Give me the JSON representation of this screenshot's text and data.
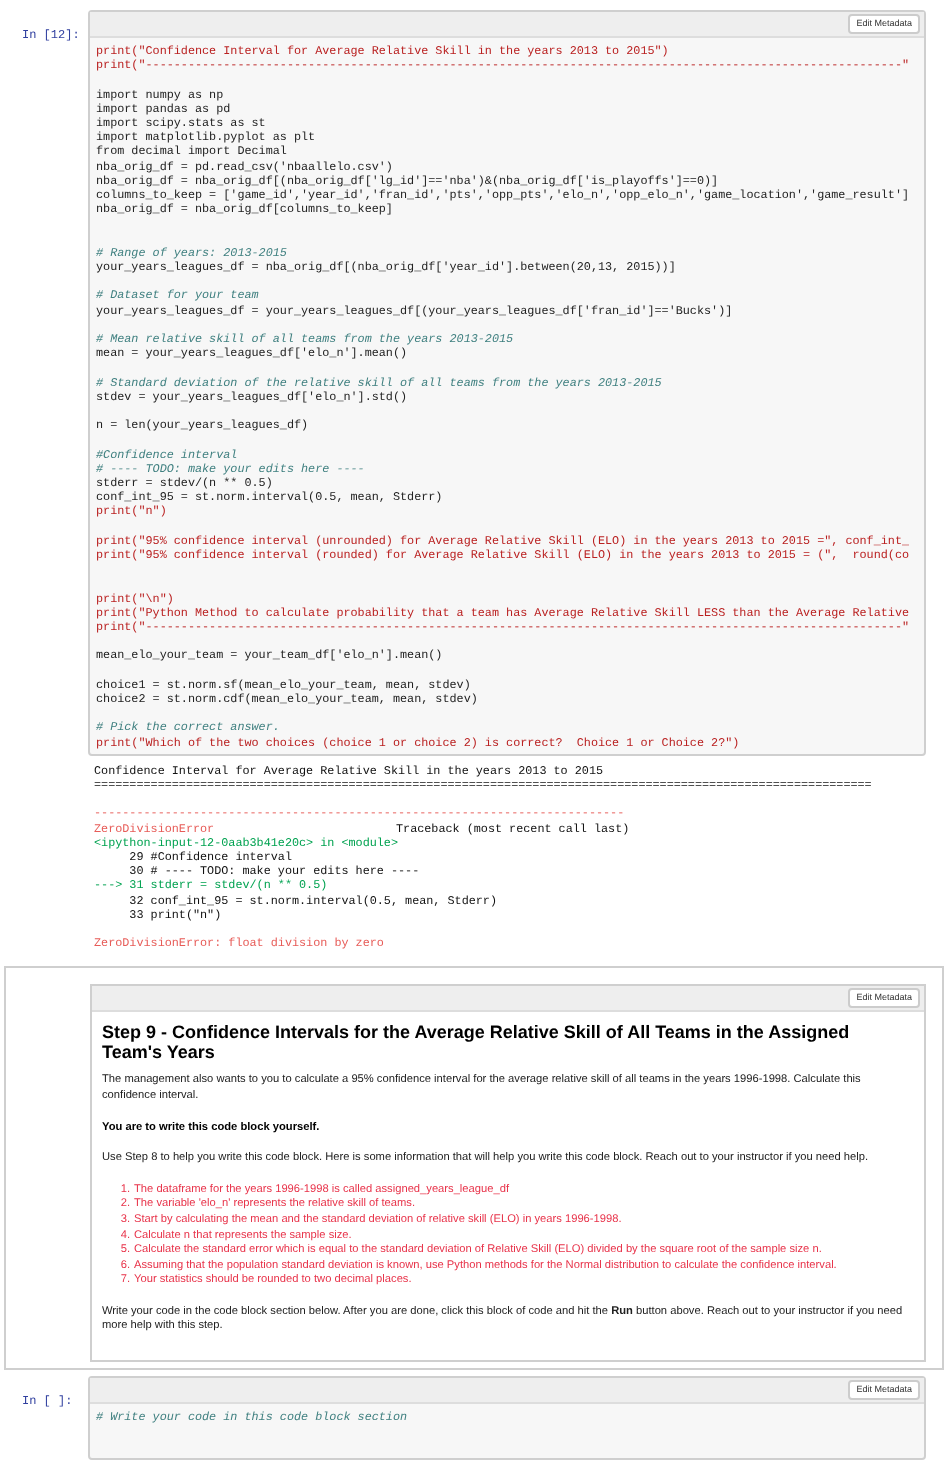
{
  "cells": [
    {
      "kind": "code",
      "prompt": "In [12]:",
      "toolbar_button": "Edit Metadata",
      "lines": [
        {
          "kind": "print",
          "text": "print(\"Confidence Interval for Average Relative Skill in the years 2013 to 2015\")"
        },
        {
          "kind": "print",
          "text": "print(\"-----------------------------------------------------------------------------------------------------------\""
        },
        {
          "kind": "blank"
        },
        {
          "kind": "code",
          "text": "import numpy as np"
        },
        {
          "kind": "code",
          "text": "import pandas as pd"
        },
        {
          "kind": "code",
          "text": "import scipy.stats as st"
        },
        {
          "kind": "code",
          "text": "import matplotlib.pyplot as plt"
        },
        {
          "kind": "code",
          "text": "from decimal import Decimal"
        },
        {
          "kind": "code",
          "text": "nba_orig_df = pd.read_csv('nbaallelo.csv')"
        },
        {
          "kind": "code",
          "text": "nba_orig_df = nba_orig_df[(nba_orig_df['lg_id']=='nba')&(nba_orig_df['is_playoffs']==0)]"
        },
        {
          "kind": "code",
          "text": "columns_to_keep = ['game_id','year_id','fran_id','pts','opp_pts','elo_n','opp_elo_n','game_location','game_result']"
        },
        {
          "kind": "code",
          "text": "nba_orig_df = nba_orig_df[columns_to_keep]"
        },
        {
          "kind": "blank"
        },
        {
          "kind": "blank"
        },
        {
          "kind": "comment",
          "text": "# Range of years: 2013-2015"
        },
        {
          "kind": "code",
          "text": "your_years_leagues_df = nba_orig_df[(nba_orig_df['year_id'].between(20,13, 2015))]"
        },
        {
          "kind": "blank"
        },
        {
          "kind": "comment",
          "text": "# Dataset for your team"
        },
        {
          "kind": "code",
          "text": "your_years_leagues_df = your_years_leagues_df[(your_years_leagues_df['fran_id']=='Bucks')]"
        },
        {
          "kind": "blank"
        },
        {
          "kind": "comment",
          "text": "# Mean relative skill of all teams from the years 2013-2015"
        },
        {
          "kind": "code",
          "text": "mean = your_years_leagues_df['elo_n'].mean()"
        },
        {
          "kind": "blank"
        },
        {
          "kind": "comment",
          "text": "# Standard deviation of the relative skill of all teams from the years 2013-2015"
        },
        {
          "kind": "code",
          "text": "stdev = your_years_leagues_df['elo_n'].std()"
        },
        {
          "kind": "blank"
        },
        {
          "kind": "code",
          "text": "n = len(your_years_leagues_df)"
        },
        {
          "kind": "blank"
        },
        {
          "kind": "comment",
          "text": "#Confidence interval"
        },
        {
          "kind": "comment",
          "text": "# ---- TODO: make your edits here ----"
        },
        {
          "kind": "code",
          "text": "stderr = stdev/(n ** 0.5)"
        },
        {
          "kind": "code",
          "text": "conf_int_95 = st.norm.interval(0.5, mean, Stderr)"
        },
        {
          "kind": "print",
          "text": "print(\"n\")"
        },
        {
          "kind": "blank"
        },
        {
          "kind": "print",
          "text": "print(\"95% confidence interval (unrounded) for Average Relative Skill (ELO) in the years 2013 to 2015 =\", conf_int_"
        },
        {
          "kind": "print",
          "text": "print(\"95% confidence interval (rounded) for Average Relative Skill (ELO) in the years 2013 to 2015 = (\",  round(co"
        },
        {
          "kind": "blank"
        },
        {
          "kind": "blank"
        },
        {
          "kind": "print",
          "text": "print(\"\\n\")"
        },
        {
          "kind": "print",
          "text": "print(\"Python Method to calculate probability that a team has Average Relative Skill LESS than the Average Relative"
        },
        {
          "kind": "print",
          "text": "print(\"-----------------------------------------------------------------------------------------------------------\""
        },
        {
          "kind": "blank"
        },
        {
          "kind": "code",
          "text": "mean_elo_your_team = your_team_df['elo_n'].mean()"
        },
        {
          "kind": "blank"
        },
        {
          "kind": "code",
          "text": "choice1 = st.norm.sf(mean_elo_your_team, mean, stdev)"
        },
        {
          "kind": "code",
          "text": "choice2 = st.norm.cdf(mean_elo_your_team, mean, stdev)"
        },
        {
          "kind": "blank"
        },
        {
          "kind": "comment",
          "text": "# Pick the correct answer."
        },
        {
          "kind": "print",
          "text": "print(\"Which of the two choices (choice 1 or choice 2) is correct?  Choice 1 or Choice 2?\")"
        }
      ],
      "output": [
        {
          "kind": "text",
          "text": "Confidence Interval for Average Relative Skill in the years 2013 to 2015"
        },
        {
          "kind": "text",
          "text": "=============================================================================================================="
        },
        {
          "kind": "blank"
        },
        {
          "kind": "error-rule",
          "text": "---------------------------------------------------------------------------"
        },
        {
          "kind": "error-header",
          "text": "ZeroDivisionError",
          "text_2": "Traceback (most recent call last)"
        },
        {
          "kind": "source",
          "text": "<ipython-input-12-0aab3b41e20c> in <module>"
        },
        {
          "kind": "context",
          "text": "     29 #Confidence interval"
        },
        {
          "kind": "context",
          "text": "     30 # ---- TODO: make your edits here ----"
        },
        {
          "kind": "current",
          "text": "---> 31 stderr = stdev/(n ** 0.5)"
        },
        {
          "kind": "context",
          "text": "     32 conf_int_95 = st.norm.interval(0.5, mean, Stderr)"
        },
        {
          "kind": "context",
          "text": "     33 print(\"n\")"
        },
        {
          "kind": "blank"
        },
        {
          "kind": "error",
          "text": "ZeroDivisionError: float division by zero"
        }
      ]
    },
    {
      "kind": "markdown",
      "toolbar_button": "Edit Metadata",
      "heading": "Step 9 - Confidence Intervals for the Average Relative Skill of All Teams in the Assigned Team's Years",
      "blocks": [
        {
          "kind": "paragraph",
          "text": "The management also wants to you to calculate a 95% confidence interval for the average relative skill of all teams in the years 1996-1998. Calculate this confidence interval."
        },
        {
          "kind": "bold",
          "text": "You are to write this code block yourself."
        },
        {
          "kind": "paragraph",
          "text": "Use Step 8 to help you write this code block. Here is some information that will help you write this code block. Reach out to your instructor if you need help."
        },
        {
          "kind": "list",
          "items": [
            {
              "number": "1.",
              "text": "The dataframe for the years 1996-1998 is called assigned_years_league_df"
            },
            {
              "number": "2.",
              "text": "The variable 'elo_n' represents the relative skill of teams."
            },
            {
              "number": "3.",
              "text": "Start by calculating the mean and the standard deviation of relative skill (ELO) in years 1996-1998."
            },
            {
              "number": "4.",
              "text": "Calculate n that represents the sample size."
            },
            {
              "number": "5.",
              "text": "Calculate the standard error which is equal to the standard deviation of Relative Skill (ELO) divided by the square root of the sample size n."
            },
            {
              "number": "6.",
              "text": "Assuming that the population standard deviation is known, use Python methods for the Normal distribution to calculate the confidence interval."
            },
            {
              "number": "7.",
              "text": "Your statistics should be rounded to two decimal places."
            }
          ]
        },
        {
          "kind": "paragraph",
          "text": "Write your code in the code block section below. After you are done, click this block of code and hit the **Run** button above. Reach out to your instructor if you need more help with this step."
        }
      ]
    },
    {
      "kind": "code",
      "prompt": "In [ ]:",
      "toolbar_button": "Edit Metadata",
      "lines": [
        {
          "kind": "comment",
          "text": "# Write your code in this code block section"
        }
      ]
    }
  ]
}
